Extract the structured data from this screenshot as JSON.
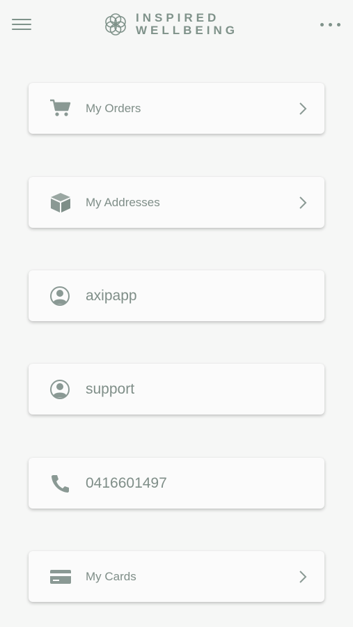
{
  "header": {
    "logo_line1": "INSPIRED",
    "logo_line2": "WELLBEING",
    "menu_icon": "hamburger-menu-icon",
    "more_icon": "more-options-icon"
  },
  "items": [
    {
      "label": "My Orders",
      "icon": "shopping-cart-icon",
      "chevron": true
    },
    {
      "label": "My Addresses",
      "icon": "box-icon",
      "chevron": true
    },
    {
      "label": "axipapp",
      "icon": "user-icon",
      "chevron": false
    },
    {
      "label": "support",
      "icon": "user-icon",
      "chevron": false
    },
    {
      "label": "0416601497",
      "icon": "phone-icon",
      "chevron": false
    },
    {
      "label": "My Cards",
      "icon": "credit-card-icon",
      "chevron": true
    }
  ],
  "colors": {
    "background": "#f6f7f6",
    "card": "#fbfbfb",
    "accent": "#7f928a",
    "text": "#7f8e88"
  }
}
